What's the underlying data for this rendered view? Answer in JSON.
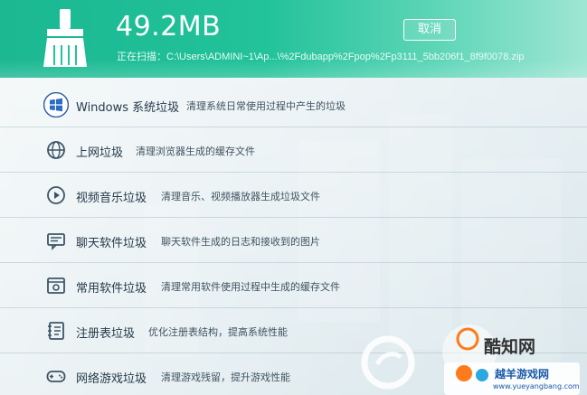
{
  "header": {
    "size": "49.2MB",
    "scan_text": "正在扫描：C:\\Users\\ADMINI~1\\Ap...\\%2Fdubapp%2Fpop%2Fp3111_5bb206f1_8f9f0078.zip",
    "cancel_label": "取消",
    "accent": "#1bb892"
  },
  "items": [
    {
      "title": "Windows 系统垃圾",
      "desc": "清理系统日常使用过程中产生的垃圾",
      "icon": "windows-icon"
    },
    {
      "title": "上网垃圾",
      "desc": "清理浏览器生成的缓存文件",
      "icon": "globe-icon"
    },
    {
      "title": "视频音乐垃圾",
      "desc": "清理音乐、视频播放器生成垃圾文件",
      "icon": "play-icon"
    },
    {
      "title": "聊天软件垃圾",
      "desc": "聊天软件生成的日志和接收到的图片",
      "icon": "chat-icon"
    },
    {
      "title": "常用软件垃圾",
      "desc": "清理常用软件使用过程中生成的缓存文件",
      "icon": "software-icon"
    },
    {
      "title": "注册表垃圾",
      "desc": "优化注册表结构，提高系统性能",
      "icon": "registry-icon"
    },
    {
      "title": "网络游戏垃圾",
      "desc": "清理游戏残留，提升游戏性能",
      "icon": "gamepad-icon"
    }
  ],
  "watermark": {
    "brand": "酷知网",
    "site_name": "越羊游戏网",
    "site_url": "www.yueyangbang.com"
  }
}
